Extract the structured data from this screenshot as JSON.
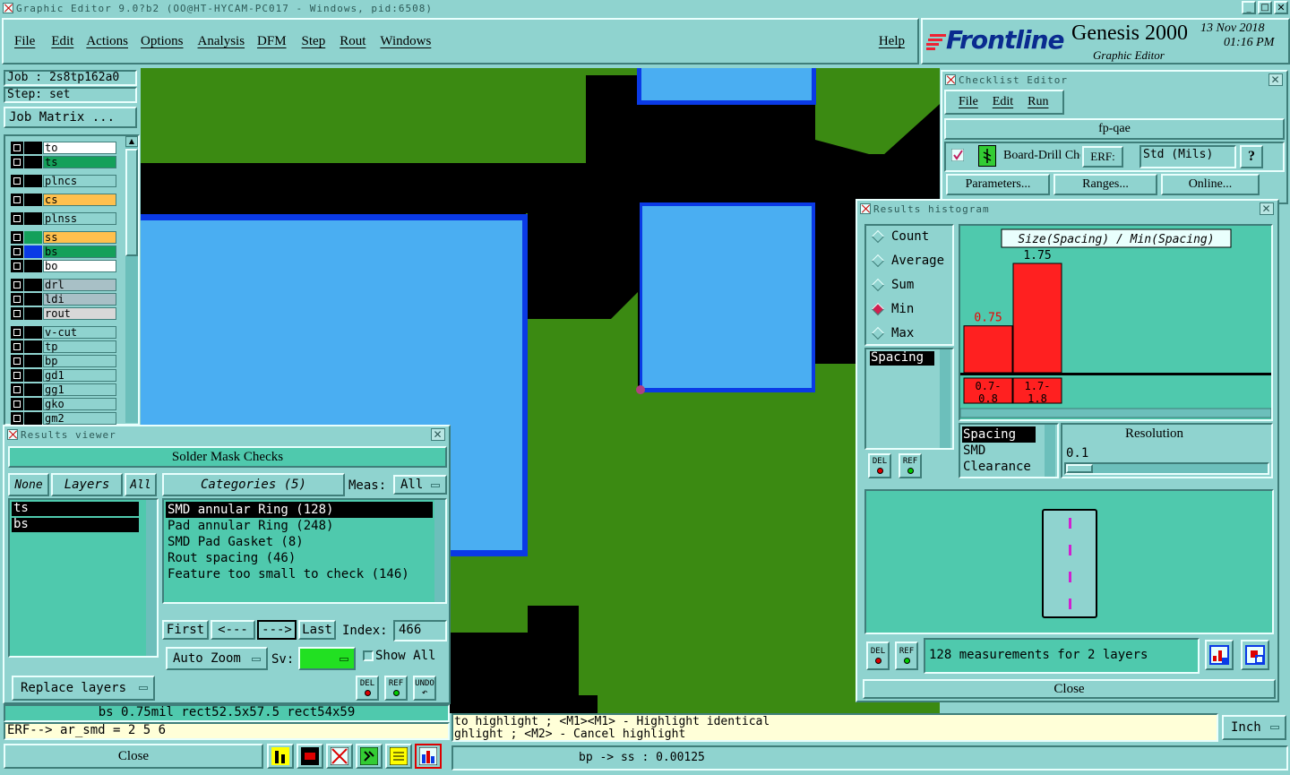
{
  "app": {
    "window_title": "Graphic Editor 9.0?b2 (OO@HT-HYCAM-PC017 - Windows, pid:6508)",
    "brand": "Frontline",
    "product": "Genesis 2000",
    "subtitle": "Graphic Editor",
    "date": "13 Nov 2018",
    "time": "01:16 PM"
  },
  "menu": {
    "items": [
      "File",
      "Edit",
      "Actions",
      "Options",
      "Analysis",
      "DFM",
      "Step",
      "Rout",
      "Windows"
    ],
    "help": "Help"
  },
  "job": {
    "job_label": "Job : 2s8tp162a0",
    "step_label": "Step: set",
    "matrix_button": "Job Matrix ..."
  },
  "layers": [
    {
      "name": "to",
      "color": "#ffffff"
    },
    {
      "name": "ts",
      "color": "#14a05a"
    },
    {
      "name": "plncs",
      "color": "#8fd3cf"
    },
    {
      "name": "cs",
      "color": "#ffc04d"
    },
    {
      "name": "plnss",
      "color": "#8fd3cf"
    },
    {
      "name": "ss",
      "color": "#ffc04d"
    },
    {
      "name": "bs",
      "color": "#14a05a"
    },
    {
      "name": "bo",
      "color": "#ffffff"
    },
    {
      "name": "drl",
      "color": "#a8c0c6"
    },
    {
      "name": "ldi",
      "color": "#a8c0c6"
    },
    {
      "name": "rout",
      "color": "#d8d8d8"
    },
    {
      "name": "v-cut",
      "color": "#8fd3cf"
    },
    {
      "name": "tp",
      "color": "#8fd3cf"
    },
    {
      "name": "bp",
      "color": "#8fd3cf"
    },
    {
      "name": "gd1",
      "color": "#8fd3cf"
    },
    {
      "name": "gg1",
      "color": "#8fd3cf"
    },
    {
      "name": "gko",
      "color": "#8fd3cf"
    },
    {
      "name": "gm2",
      "color": "#8fd3cf"
    }
  ],
  "results_viewer": {
    "title": "Results viewer",
    "heading": "Solder Mask Checks",
    "none_btn": "None",
    "layers_label": "Layers",
    "all_btn": "All",
    "categories_label": "Categories (5)",
    "meas_label": "Meas:",
    "meas_value": "All",
    "layer_list": [
      "ts",
      "bs"
    ],
    "categories": [
      "SMD annular Ring (128)",
      "Pad annular Ring (248)",
      "SMD Pad Gasket (8)",
      "Rout spacing (46)",
      "Feature too small to check (146)"
    ],
    "first": "First",
    "prev": "<---",
    "next": "--->",
    "last": "Last",
    "index_label": "Index:",
    "index_value": "466",
    "auto_zoom": "Auto Zoom",
    "sv_label": "Sv:",
    "show_all": "Show All",
    "replace_layers": "Replace layers",
    "del": "DEL",
    "ref": "REF",
    "undo": "UNDO",
    "status": "bs 0.75mil  rect52.5x57.5  rect54x59",
    "erf_line": "ERF--> ar_smd = 2 5 6",
    "close": "Close"
  },
  "checklist": {
    "title": "Checklist Editor",
    "menu": [
      "File",
      "Edit",
      "Run"
    ],
    "name": "fp-qae",
    "check_name": "Board-Drill Che",
    "erf_label": "ERF:",
    "erf_value": "Std (Mils)",
    "help_icon": "?",
    "buttons": [
      "Parameters...",
      "Ranges...",
      "Online..."
    ]
  },
  "histogram": {
    "title": "Results histogram",
    "modes": [
      "Count",
      "Average",
      "Sum",
      "Min",
      "Max"
    ],
    "selected_mode": "Min",
    "measure_list": [
      "Spacing"
    ],
    "chart_title": "Size(Spacing) / Min(Spacing)",
    "resolution_label": "Resolution",
    "resolution_value": "0.1",
    "type_list": [
      "Spacing",
      "SMD",
      "Clearance"
    ],
    "summary": "128 measurements for 2 layers",
    "close": "Close",
    "del": "DEL",
    "ref": "REF"
  },
  "chart_data": {
    "type": "bar",
    "title": "Size(Spacing) / Min(Spacing)",
    "categories": [
      "0.7-0.8",
      "1.7-1.8"
    ],
    "category_lines": [
      [
        "0.7-",
        "0.8"
      ],
      [
        "1.7-",
        "1.8"
      ]
    ],
    "values": [
      0.75,
      1.75
    ],
    "value_labels": [
      "0.75",
      "1.75"
    ],
    "ylim": [
      0,
      1.75
    ],
    "bar_color": "#ff2020"
  },
  "messages": {
    "line1": "to highlight ; <M1><M1> - Highlight identical",
    "line2": "ghlight ; <M2> - Cancel highlight",
    "units": "Inch",
    "coord": "bp -> ss : 0.00125"
  },
  "colors": {
    "background": "#8fd3cf",
    "canvas_green": "#3b8a12",
    "copper_blue": "#4aaef2",
    "outline_blue": "#0a3ae6",
    "panel_teal": "#4fc9ad"
  }
}
